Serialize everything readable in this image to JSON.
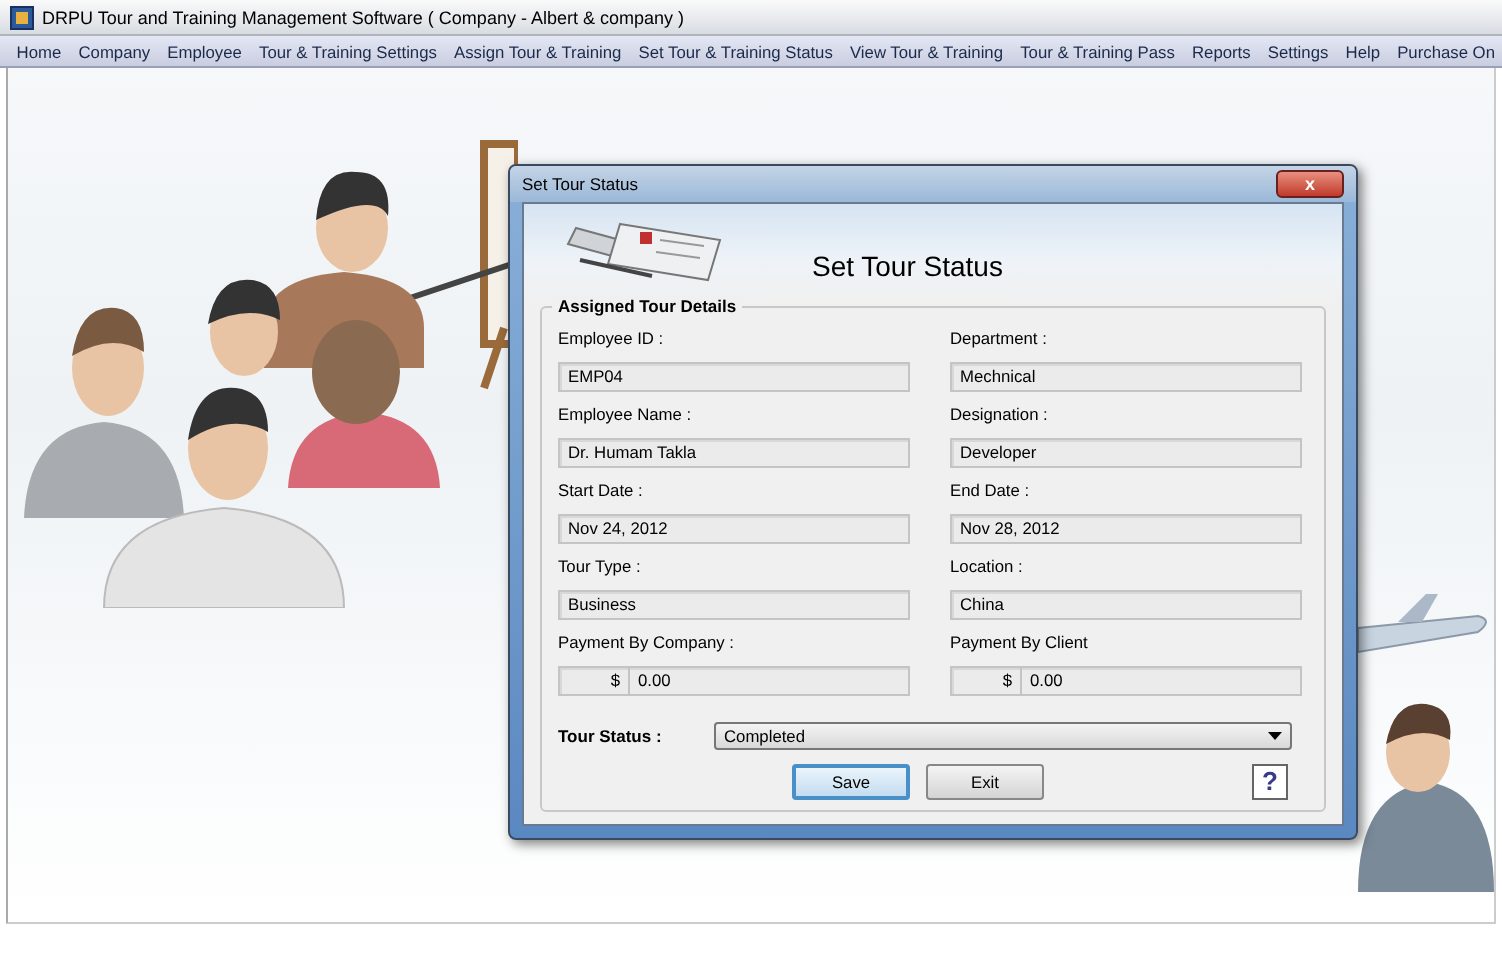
{
  "window": {
    "title": "DRPU Tour and Training Management Software ( Company - Albert & company )"
  },
  "menu": [
    {
      "label": "Home"
    },
    {
      "label": "Company"
    },
    {
      "label": "Employee"
    },
    {
      "label": "Tour & Training Settings"
    },
    {
      "label": "Assign Tour & Training"
    },
    {
      "label": "Set Tour & Training Status"
    },
    {
      "label": "View Tour & Training"
    },
    {
      "label": "Tour & Training Pass"
    },
    {
      "label": "Reports"
    },
    {
      "label": "Settings"
    },
    {
      "label": "Help"
    },
    {
      "label": "Purchase On"
    }
  ],
  "dialog": {
    "title": "Set Tour Status",
    "close": "x",
    "heading": "Set Tour Status",
    "group_title": "Assigned Tour Details",
    "fields": [
      {
        "kind": "text",
        "label": "Employee ID :",
        "value": "EMP04"
      },
      {
        "kind": "text",
        "label": "Department :",
        "value": "Mechnical"
      },
      {
        "kind": "text",
        "label": "Employee Name :",
        "value": "Dr. Humam Takla"
      },
      {
        "kind": "text",
        "label": "Designation :",
        "value": "Developer"
      },
      {
        "kind": "text",
        "label": "Start Date :",
        "value": "Nov 24, 2012"
      },
      {
        "kind": "text",
        "label": "End Date :",
        "value": "Nov 28, 2012"
      },
      {
        "kind": "text",
        "label": "Tour Type :",
        "value": "Business"
      },
      {
        "kind": "text",
        "label": "Location :",
        "value": "China"
      },
      {
        "kind": "money",
        "label": "Payment By Company :",
        "prefix": "$",
        "value": "0.00"
      },
      {
        "kind": "money",
        "label": "Payment By Client",
        "prefix": "$",
        "value": "0.00"
      }
    ],
    "status": {
      "label": "Tour Status :",
      "value": "Completed"
    },
    "buttons": [
      {
        "label": "Save",
        "focused": true
      },
      {
        "label": "Exit",
        "focused": false
      }
    ],
    "help": "?"
  }
}
